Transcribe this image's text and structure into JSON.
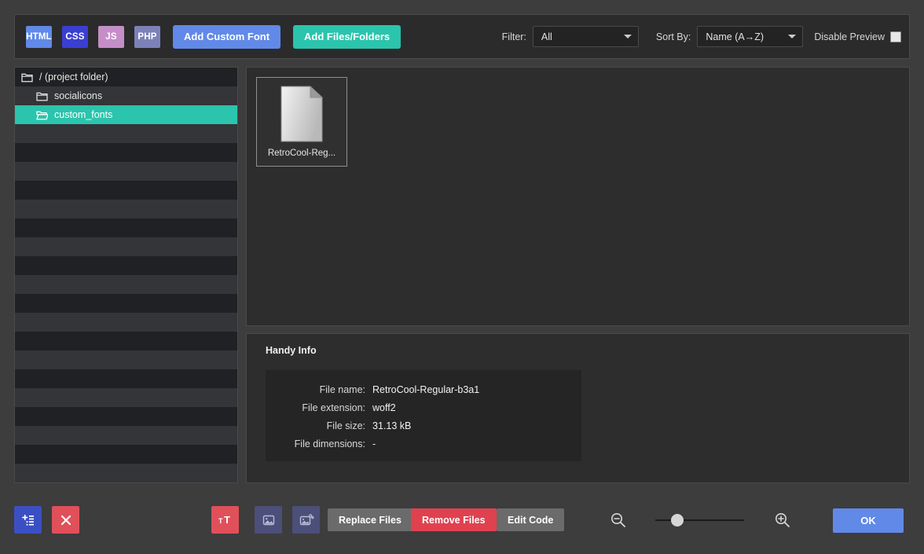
{
  "toolbar": {
    "tags": [
      {
        "label": "HTML",
        "color": "#6189e8",
        "name": "html-tag-button"
      },
      {
        "label": "CSS",
        "color": "#3b3fd1",
        "name": "css-tag-button"
      },
      {
        "label": "JS",
        "color": "#c58ec9",
        "name": "js-tag-button"
      },
      {
        "label": "PHP",
        "color": "#7c82b8",
        "name": "php-tag-button"
      }
    ],
    "add_custom_font": "Add Custom Font",
    "add_custom_font_color": "#6189e8",
    "add_files_folders": "Add Files/Folders",
    "add_files_folders_color": "#2bc4ac",
    "filter_label": "Filter:",
    "filter_value": "All",
    "sort_label": "Sort By:",
    "sort_value": "Name (A→Z)",
    "disable_preview_label": "Disable Preview",
    "disable_preview_checked": false
  },
  "sidebar": {
    "rows": [
      {
        "label": "/ (project folder)",
        "indent": 0,
        "icon": "folder-closed-icon",
        "selected": false,
        "stripe": "odd"
      },
      {
        "label": "socialicons",
        "indent": 1,
        "icon": "folder-closed-icon",
        "selected": false,
        "stripe": "even"
      },
      {
        "label": "custom_fonts",
        "indent": 1,
        "icon": "folder-open-icon",
        "selected": true,
        "stripe": "odd"
      },
      {
        "label": "",
        "indent": 0,
        "icon": "",
        "selected": false,
        "stripe": "even"
      },
      {
        "label": "",
        "indent": 0,
        "icon": "",
        "selected": false,
        "stripe": "odd"
      },
      {
        "label": "",
        "indent": 0,
        "icon": "",
        "selected": false,
        "stripe": "even"
      },
      {
        "label": "",
        "indent": 0,
        "icon": "",
        "selected": false,
        "stripe": "odd"
      },
      {
        "label": "",
        "indent": 0,
        "icon": "",
        "selected": false,
        "stripe": "even"
      },
      {
        "label": "",
        "indent": 0,
        "icon": "",
        "selected": false,
        "stripe": "odd"
      },
      {
        "label": "",
        "indent": 0,
        "icon": "",
        "selected": false,
        "stripe": "even"
      },
      {
        "label": "",
        "indent": 0,
        "icon": "",
        "selected": false,
        "stripe": "odd"
      },
      {
        "label": "",
        "indent": 0,
        "icon": "",
        "selected": false,
        "stripe": "even"
      },
      {
        "label": "",
        "indent": 0,
        "icon": "",
        "selected": false,
        "stripe": "odd"
      },
      {
        "label": "",
        "indent": 0,
        "icon": "",
        "selected": false,
        "stripe": "even"
      },
      {
        "label": "",
        "indent": 0,
        "icon": "",
        "selected": false,
        "stripe": "odd"
      },
      {
        "label": "",
        "indent": 0,
        "icon": "",
        "selected": false,
        "stripe": "even"
      },
      {
        "label": "",
        "indent": 0,
        "icon": "",
        "selected": false,
        "stripe": "odd"
      },
      {
        "label": "",
        "indent": 0,
        "icon": "",
        "selected": false,
        "stripe": "even"
      },
      {
        "label": "",
        "indent": 0,
        "icon": "",
        "selected": false,
        "stripe": "odd"
      },
      {
        "label": "",
        "indent": 0,
        "icon": "",
        "selected": false,
        "stripe": "even"
      },
      {
        "label": "",
        "indent": 0,
        "icon": "",
        "selected": false,
        "stripe": "odd"
      },
      {
        "label": "",
        "indent": 0,
        "icon": "",
        "selected": false,
        "stripe": "even"
      }
    ],
    "selected_color": "#2bc4ac"
  },
  "preview": {
    "files": [
      {
        "name": "RetroCool-Reg...",
        "icon": "document-icon"
      }
    ]
  },
  "info": {
    "title": "Handy Info",
    "rows": [
      {
        "key": "File name:",
        "value": "RetroCool-Regular-b3a1"
      },
      {
        "key": "File extension:",
        "value": "woff2"
      },
      {
        "key": "File size:",
        "value": "31.13 kB"
      },
      {
        "key": "File dimensions:",
        "value": "-"
      }
    ]
  },
  "bottom": {
    "add_button_name": "add-files-icon-button",
    "add_button_color": "#3b4fc4",
    "delete_button_color": "#e0505a",
    "text_tool_color": "#e0505a",
    "image_tool_color": "#4b4f7a",
    "replace_files": "Replace Files",
    "replace_files_color": "#6b6b6b",
    "remove_files": "Remove Files",
    "remove_files_color": "#e0414f",
    "edit_code": "Edit Code",
    "edit_code_color": "#6b6b6b",
    "zoom_out_icon": "zoom-out-icon",
    "zoom_in_icon": "zoom-in-icon",
    "zoom_slider_value": 25,
    "ok": "OK",
    "ok_color": "#6189e8"
  }
}
